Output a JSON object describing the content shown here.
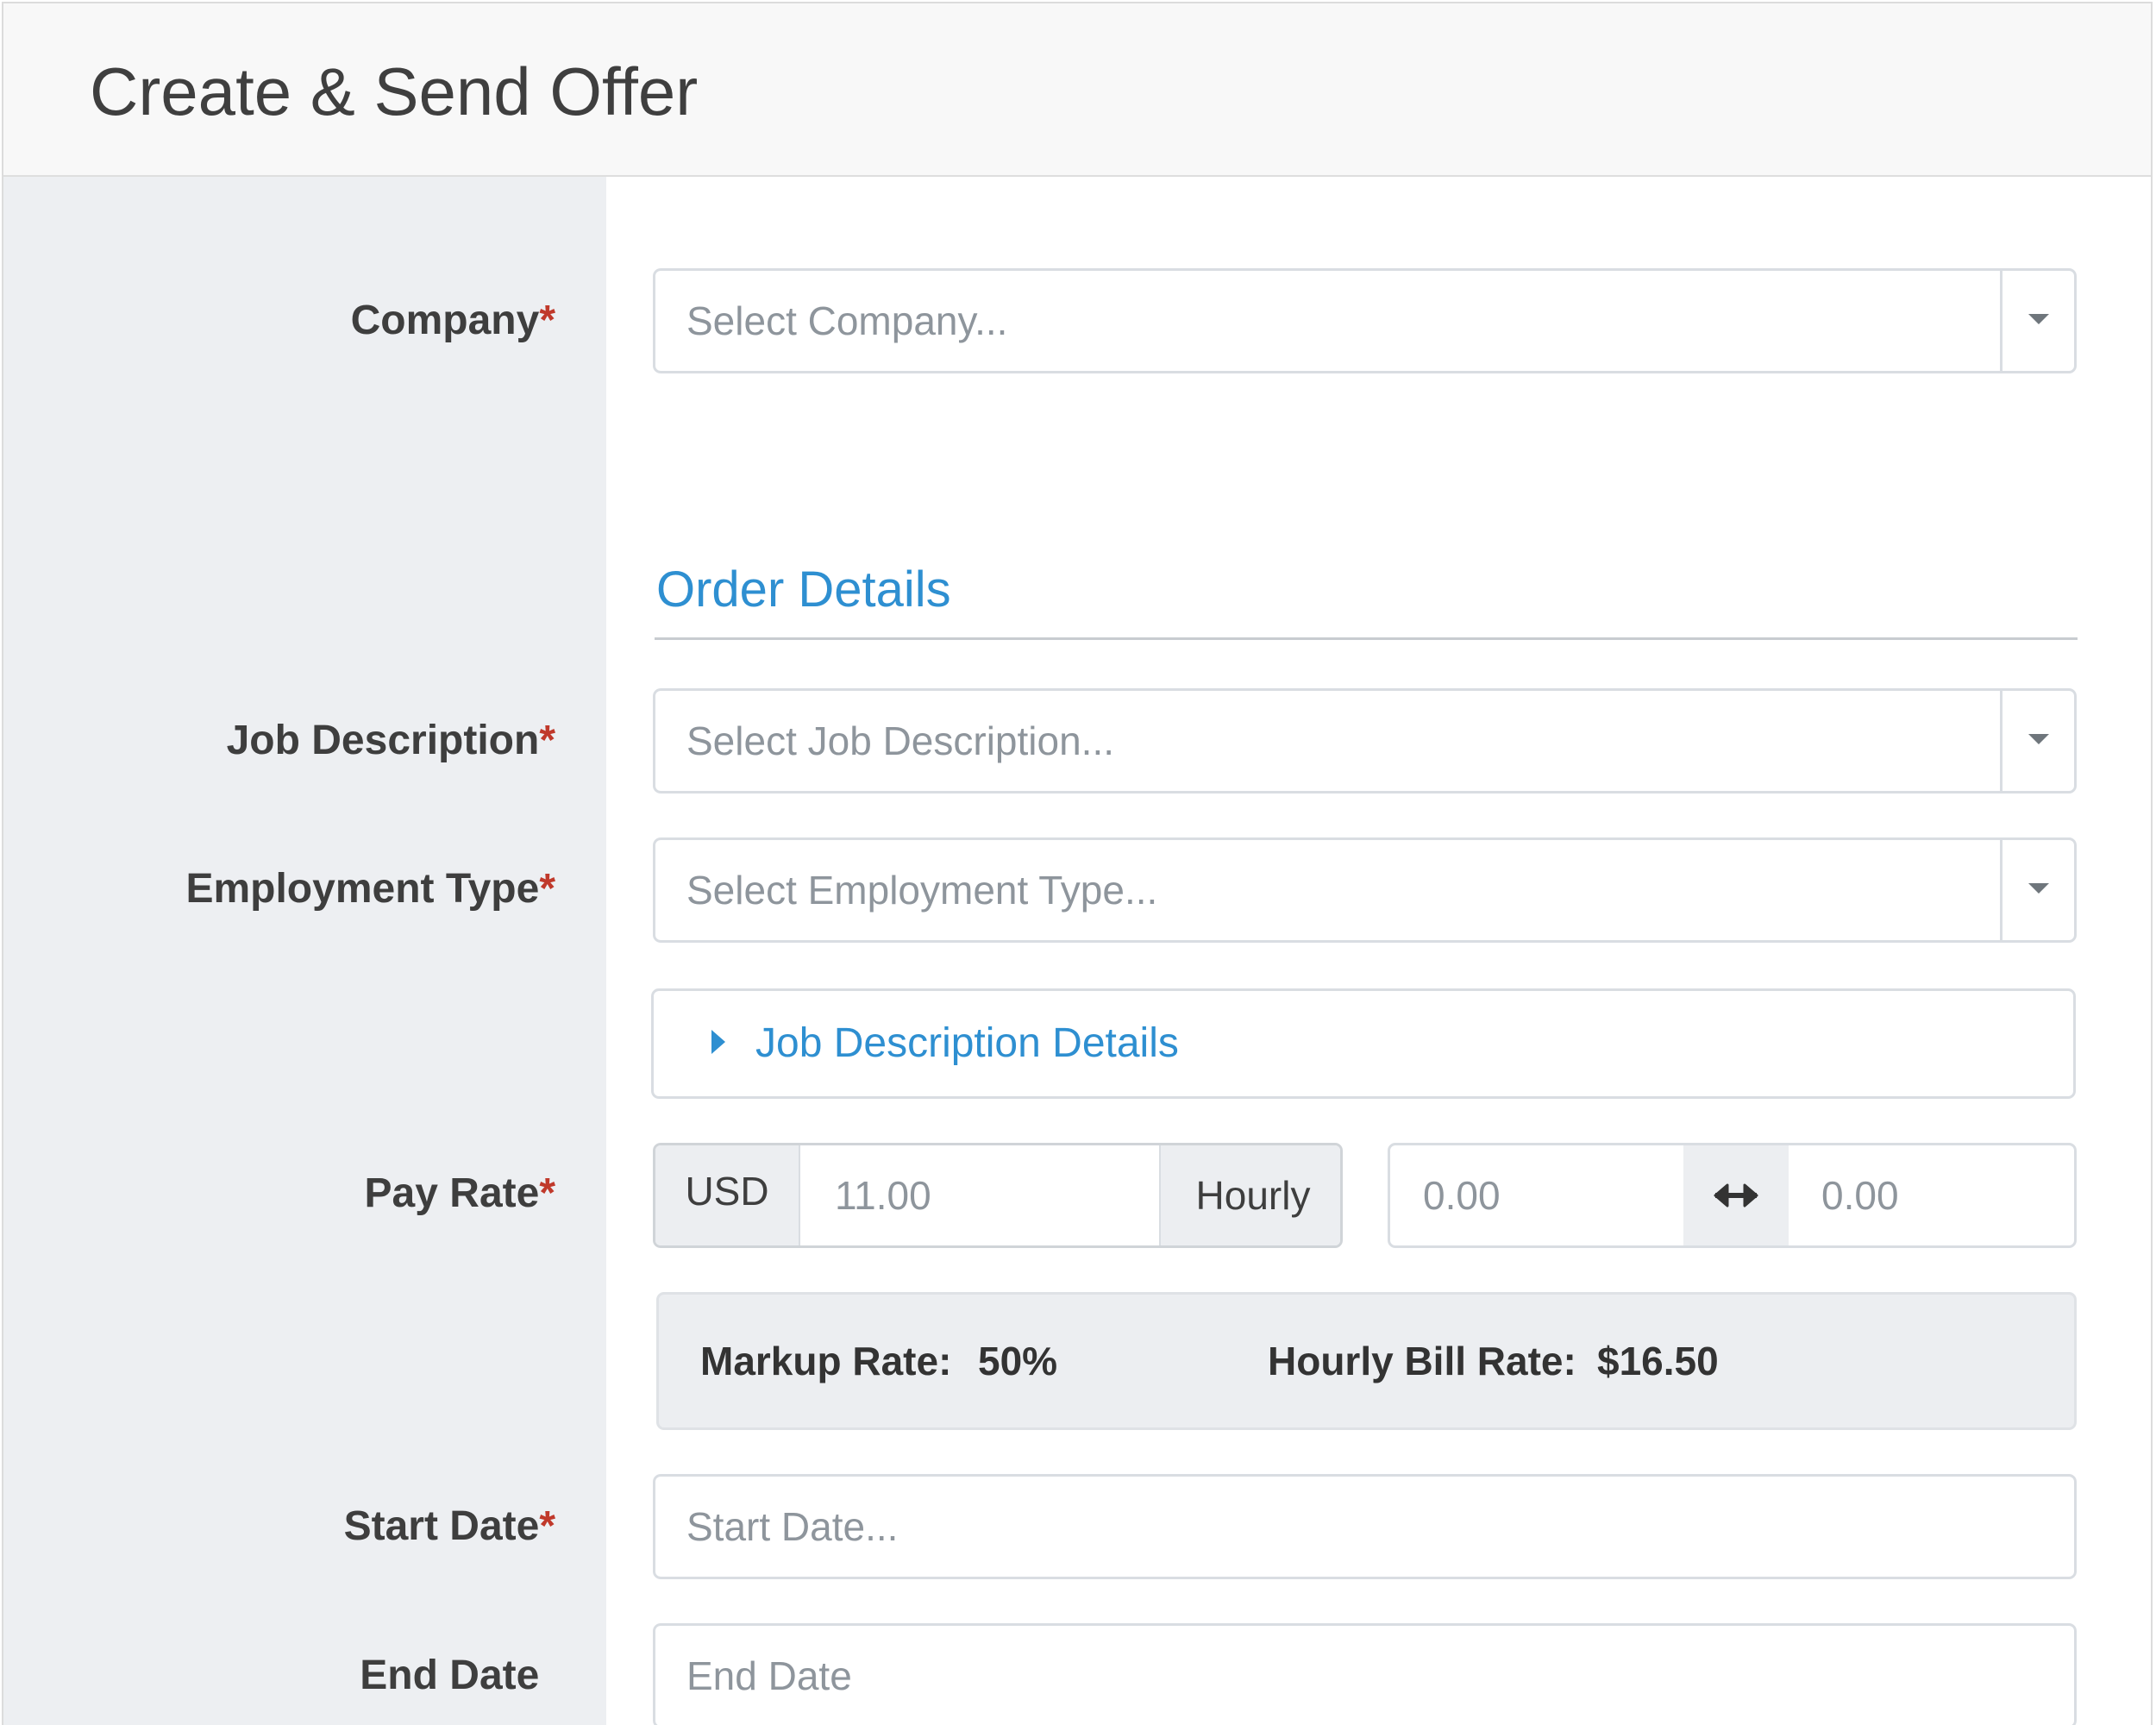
{
  "header": {
    "title": "Create & Send Offer"
  },
  "required_marker": "*",
  "company": {
    "label": "Company",
    "placeholder": "Select Company..."
  },
  "order_details": {
    "title": "Order Details"
  },
  "job_description": {
    "label": "Job Description",
    "placeholder": "Select Job Description..."
  },
  "employment_type": {
    "label": "Employment Type",
    "placeholder": "Select Employment Type..."
  },
  "job_description_details": {
    "label": "Job Description Details"
  },
  "pay_rate": {
    "label": "Pay Rate",
    "currency": "USD",
    "value_placeholder": "11.00",
    "period": "Hourly",
    "range_min_placeholder": "0.00",
    "range_max_placeholder": "0.00"
  },
  "rate_summary": {
    "markup_label": "Markup Rate:",
    "markup_value": "50%",
    "bill_label": "Hourly Bill Rate:",
    "bill_value": "$16.50"
  },
  "start_date": {
    "label": "Start Date",
    "placeholder": "Start Date..."
  },
  "end_date": {
    "label": "End Date",
    "placeholder": "End Date"
  },
  "colors": {
    "accent": "#2e8fd1",
    "required": "#c0392b",
    "label_panel": "#edeff2",
    "header_bg": "#f8f8f8"
  },
  "icons": {
    "dropdown": "caret-down-icon",
    "expand": "caret-right-icon",
    "range": "left-right-arrow-icon"
  }
}
